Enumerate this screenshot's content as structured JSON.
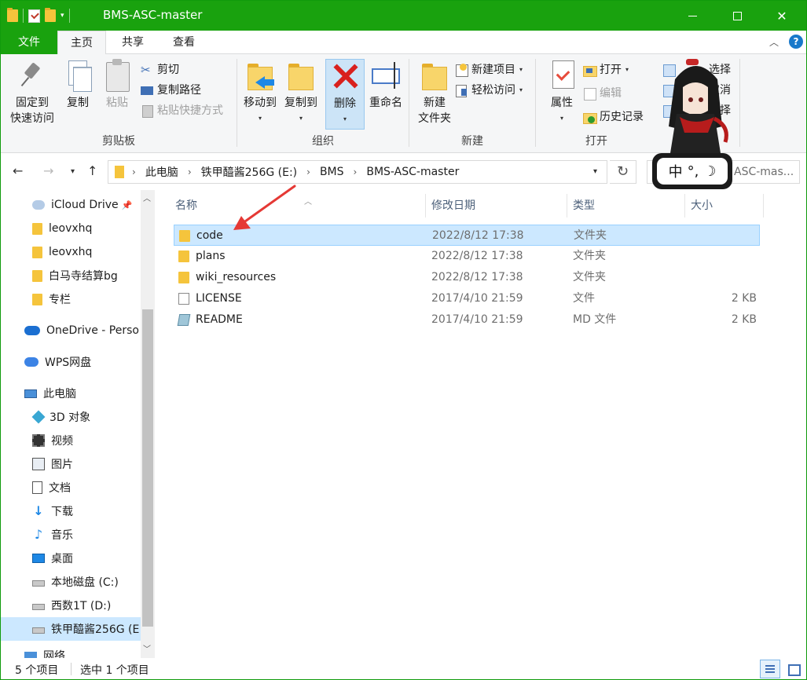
{
  "window": {
    "title": "BMS-ASC-master"
  },
  "ribbon_tabs": [
    "文件",
    "主页",
    "共享",
    "查看"
  ],
  "ribbon": {
    "clipboard": {
      "label": "剪贴板",
      "pin": "固定到",
      "pin2": "快速访问",
      "copy": "复制",
      "paste": "粘贴",
      "cut": "剪切",
      "copy_path": "复制路径",
      "paste_shortcut": "粘贴快捷方式"
    },
    "organize": {
      "label": "组织",
      "move_to": "移动到",
      "copy_to": "复制到",
      "delete": "删除",
      "rename": "重命名"
    },
    "new": {
      "label": "新建",
      "new_folder": "新建",
      "new_folder2": "文件夹",
      "new_item": "新建项目",
      "easy_access": "轻松访问"
    },
    "open": {
      "label": "打开",
      "properties": "属性",
      "open": "打开",
      "edit": "编辑",
      "history": "历史记录"
    },
    "select": {
      "select_all_tail": "选择",
      "select_none_tail": "取消",
      "invert_tail": "选择"
    }
  },
  "address": {
    "crumbs": [
      "此电脑",
      "铁甲醯酱256G (E:)",
      "BMS",
      "BMS-ASC-master"
    ],
    "search_text": "ASC-mas..."
  },
  "ime": {
    "mode": "中",
    "punct": "°,",
    "moon": "☽"
  },
  "sidebar": {
    "items": [
      {
        "label": "iCloud Drive",
        "icon": "icloud-icon",
        "pinned": true
      },
      {
        "label": "leovxhq",
        "icon": "folder-icon"
      },
      {
        "label": "leovxhq",
        "icon": "folder-icon"
      },
      {
        "label": "白马寺结算bg",
        "icon": "folder-icon"
      },
      {
        "label": "专栏",
        "icon": "folder-icon"
      },
      {
        "label": "OneDrive - Perso",
        "icon": "onedrive-icon"
      },
      {
        "label": "WPS网盘",
        "icon": "wps-cloud-icon"
      },
      {
        "label": "此电脑",
        "icon": "this-pc-icon"
      },
      {
        "label": "3D 对象",
        "icon": "3d-objects-icon"
      },
      {
        "label": "视频",
        "icon": "videos-icon"
      },
      {
        "label": "图片",
        "icon": "pictures-icon"
      },
      {
        "label": "文档",
        "icon": "documents-icon"
      },
      {
        "label": "下载",
        "icon": "downloads-icon"
      },
      {
        "label": "音乐",
        "icon": "music-icon"
      },
      {
        "label": "桌面",
        "icon": "desktop-icon"
      },
      {
        "label": "本地磁盘 (C:)",
        "icon": "local-disk-icon"
      },
      {
        "label": "西数1T (D:)",
        "icon": "drive-icon"
      },
      {
        "label": "铁甲醯酱256G (E",
        "icon": "drive-icon",
        "selected": true
      },
      {
        "label": "网络",
        "icon": "network-icon"
      }
    ]
  },
  "columns": {
    "name": "名称",
    "date": "修改日期",
    "type": "类型",
    "size": "大小"
  },
  "files": [
    {
      "name": "code",
      "date": "2022/8/12 17:38",
      "type": "文件夹",
      "size": "",
      "kind": "folder",
      "selected": true
    },
    {
      "name": "plans",
      "date": "2022/8/12 17:38",
      "type": "文件夹",
      "size": "",
      "kind": "folder"
    },
    {
      "name": "wiki_resources",
      "date": "2022/8/12 17:38",
      "type": "文件夹",
      "size": "",
      "kind": "folder"
    },
    {
      "name": "LICENSE",
      "date": "2017/4/10 21:59",
      "type": "文件",
      "size": "2 KB",
      "kind": "file"
    },
    {
      "name": "README",
      "date": "2017/4/10 21:59",
      "type": "MD 文件",
      "size": "2 KB",
      "kind": "md"
    }
  ],
  "status": {
    "count": "5 个项目",
    "selected": "选中 1 个项目"
  },
  "colors": {
    "titlebar": "#19a20e",
    "selection": "#cce8ff",
    "annotation_arrow": "#e53935"
  }
}
